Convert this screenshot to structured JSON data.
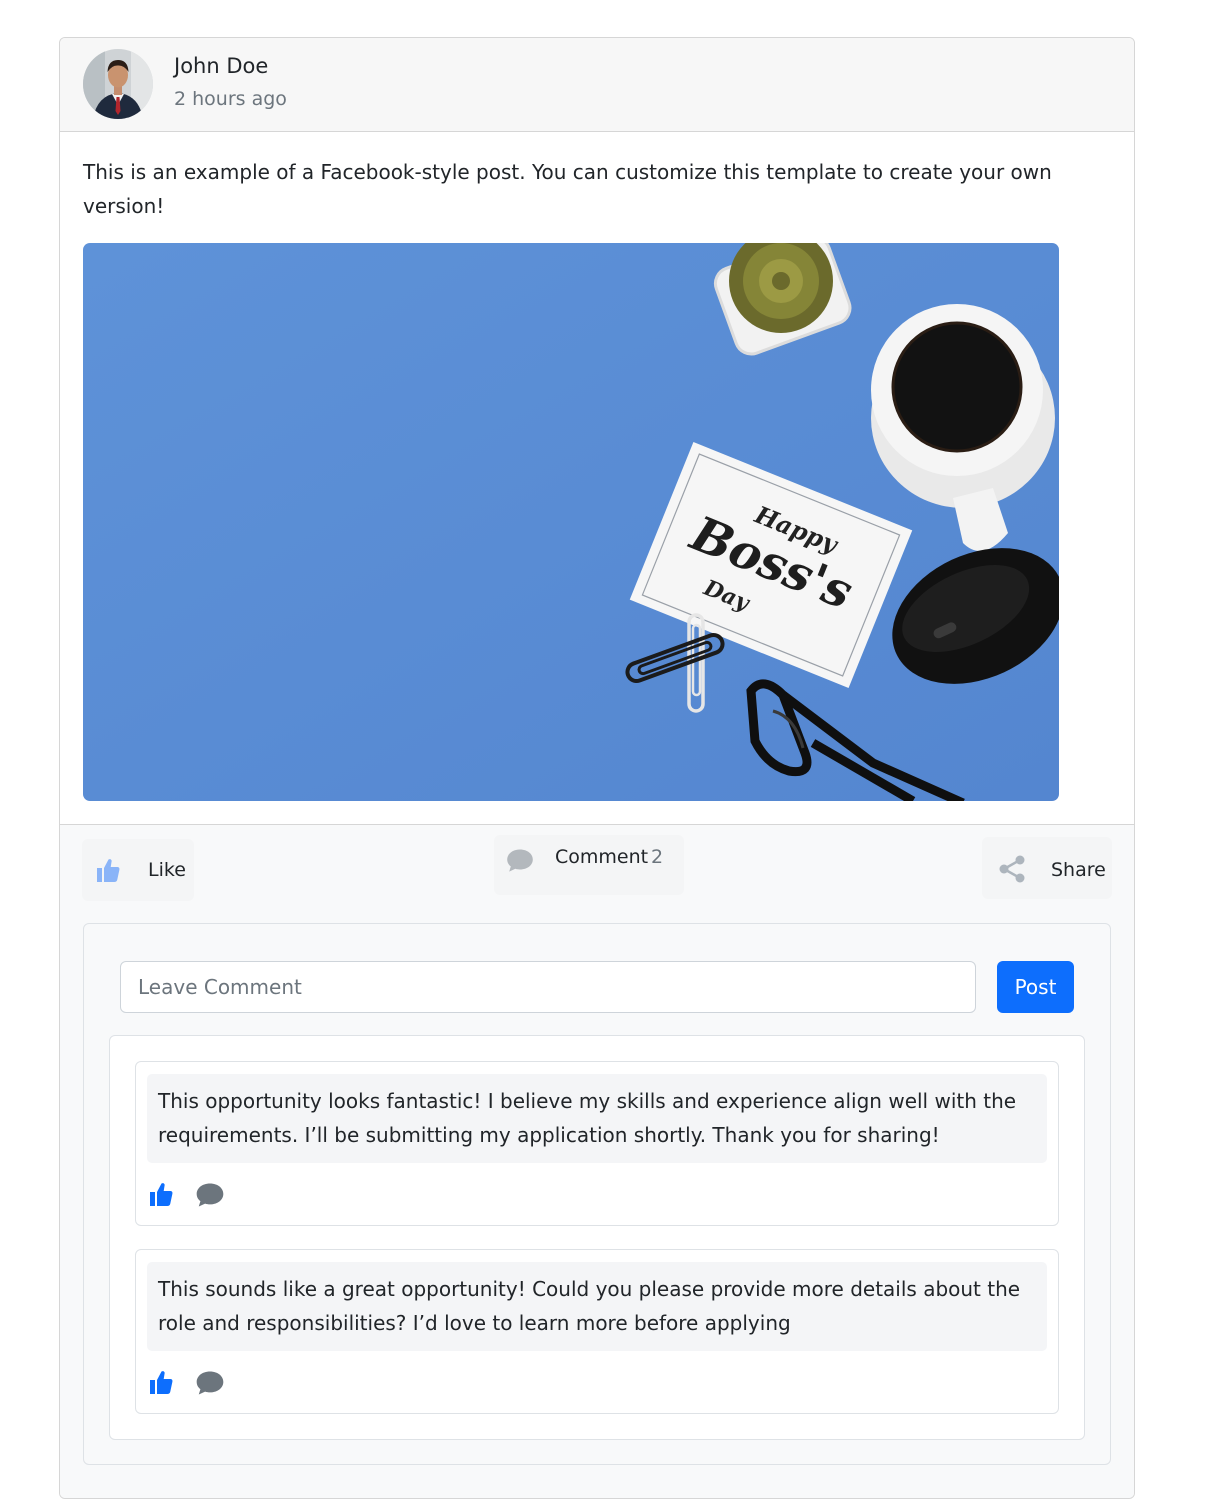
{
  "post": {
    "author": "John Doe",
    "time": "2 hours ago",
    "text": "This is an example of a Facebook-style post. You can customize this template to create your own version!",
    "image": {
      "card_text": [
        "Happy",
        "Boss's",
        "Day"
      ]
    }
  },
  "actions": {
    "like_label": "Like",
    "comment_label": "Comment",
    "comment_count": "2",
    "share_label": "Share"
  },
  "comment_form": {
    "placeholder": "Leave Comment",
    "submit_label": "Post"
  },
  "comments": [
    {
      "text": "This opportunity looks fantastic! I believe my skills and experience align well with the requirements. I’ll be submitting my application shortly. Thank you for sharing!"
    },
    {
      "text": "This sounds like a great opportunity! Could you please provide more details about the role and responsibilities? I’d love to learn more before applying"
    }
  ],
  "colors": {
    "primary": "#0d6efd",
    "like_light": "#8ab4f8",
    "muted_icon": "#6c757d",
    "share_icon": "#adb5bd",
    "image_background": "#5b8fd6"
  },
  "icons": {
    "like": "thumbs-up-icon",
    "comment": "speech-bubble-icon",
    "share": "share-nodes-icon"
  }
}
